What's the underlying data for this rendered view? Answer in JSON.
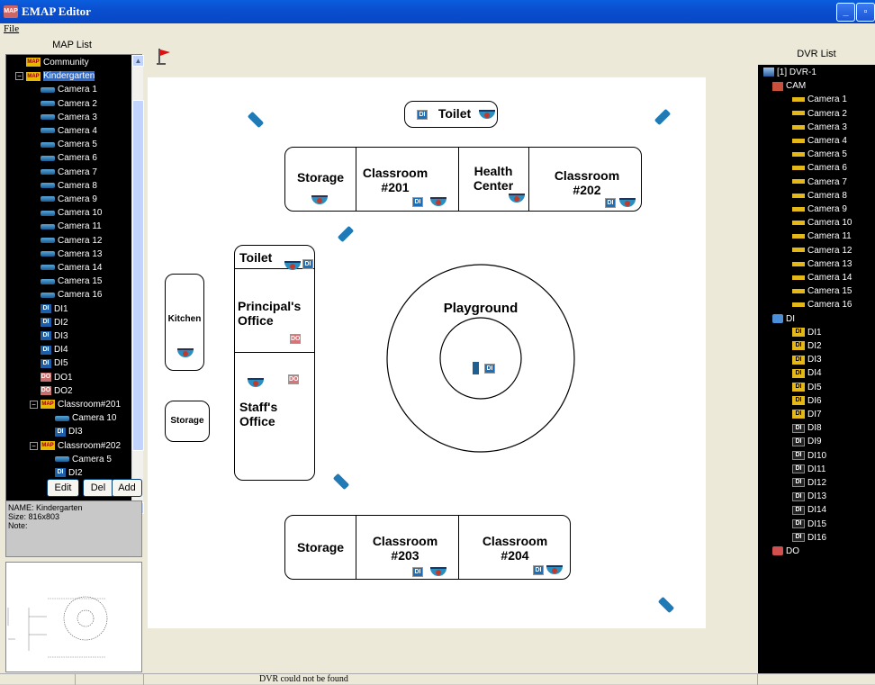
{
  "app": {
    "title": "EMAP Editor",
    "icon_text": "MAP"
  },
  "menu": {
    "file": "File"
  },
  "left_panel": {
    "title": "MAP List",
    "tree": [
      {
        "label": "Community",
        "icon": "map"
      },
      {
        "label": "Kindergarten",
        "icon": "map",
        "selected": true
      },
      {
        "label": "Camera 1",
        "icon": "cam"
      },
      {
        "label": "Camera 2",
        "icon": "cam"
      },
      {
        "label": "Camera 3",
        "icon": "cam"
      },
      {
        "label": "Camera 4",
        "icon": "cam"
      },
      {
        "label": "Camera 5",
        "icon": "cam"
      },
      {
        "label": "Camera 6",
        "icon": "cam"
      },
      {
        "label": "Camera 7",
        "icon": "cam"
      },
      {
        "label": "Camera 8",
        "icon": "cam"
      },
      {
        "label": "Camera 9",
        "icon": "cam"
      },
      {
        "label": "Camera 10",
        "icon": "cam"
      },
      {
        "label": "Camera 11",
        "icon": "cam"
      },
      {
        "label": "Camera 12",
        "icon": "cam"
      },
      {
        "label": "Camera 13",
        "icon": "cam"
      },
      {
        "label": "Camera 14",
        "icon": "cam"
      },
      {
        "label": "Camera 15",
        "icon": "cam"
      },
      {
        "label": "Camera 16",
        "icon": "cam"
      },
      {
        "label": "DI1",
        "icon": "di"
      },
      {
        "label": "DI2",
        "icon": "di"
      },
      {
        "label": "DI3",
        "icon": "di"
      },
      {
        "label": "DI4",
        "icon": "di"
      },
      {
        "label": "DI5",
        "icon": "di"
      },
      {
        "label": "DO1",
        "icon": "do"
      },
      {
        "label": "DO2",
        "icon": "do"
      },
      {
        "label": "Classroom#201",
        "icon": "map"
      },
      {
        "label": "Camera 10",
        "icon": "cam"
      },
      {
        "label": "DI3",
        "icon": "di"
      },
      {
        "label": "Classroom#202",
        "icon": "map"
      },
      {
        "label": "Camera 5",
        "icon": "cam"
      },
      {
        "label": "DI2",
        "icon": "di"
      }
    ],
    "buttons": {
      "edit": "Edit",
      "del": "Del",
      "add": "Add"
    },
    "info": {
      "name": "NAME: Kindergarten",
      "size": "Size: 816x803",
      "note": "Note:"
    }
  },
  "map": {
    "rooms": {
      "toilet_top": "Toilet",
      "storage_top": "Storage",
      "classroom_201": "Classroom #201",
      "health_center": "Health Center",
      "classroom_202": "Classroom #202",
      "toilet_left": "Toilet",
      "principal": "Principal's Office",
      "staff": "Staff's Office",
      "kitchen": "Kitchen",
      "storage_left": "Storage",
      "playground": "Playground",
      "storage_bottom": "Storage",
      "classroom_203": "Classroom #203",
      "classroom_204": "Classroom #204"
    },
    "tags": {
      "di": "DI",
      "do": "DO"
    }
  },
  "right_panel": {
    "title": "DVR List",
    "dvr": "[1] DVR-1",
    "cam_folder": "CAM",
    "cameras": [
      "Camera 1",
      "Camera 2",
      "Camera 3",
      "Camera 4",
      "Camera 5",
      "Camera 6",
      "Camera 7",
      "Camera 8",
      "Camera 9",
      "Camera 10",
      "Camera 11",
      "Camera 12",
      "Camera 13",
      "Camera 14",
      "Camera 15",
      "Camera 16"
    ],
    "di_folder": "DI",
    "dis": [
      "DI1",
      "DI2",
      "DI3",
      "DI4",
      "DI5",
      "DI6",
      "DI7",
      "DI8",
      "DI9",
      "DI10",
      "DI11",
      "DI12",
      "DI13",
      "DI14",
      "DI15",
      "DI16"
    ],
    "do_folder": "DO"
  },
  "status": {
    "text": "DVR could not be found"
  }
}
